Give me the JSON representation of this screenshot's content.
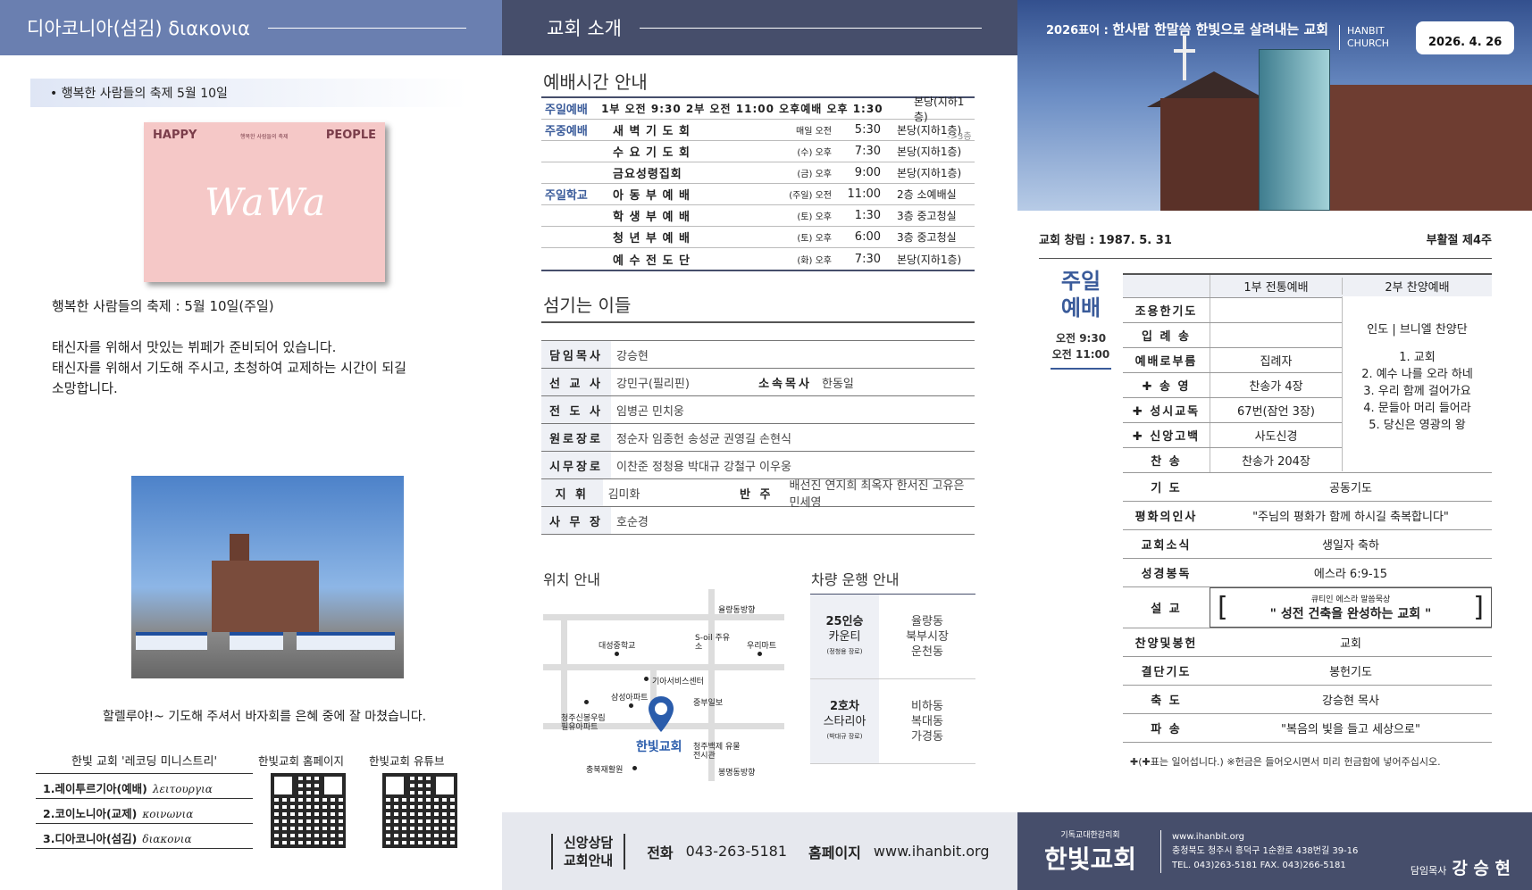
{
  "diakonia": {
    "header": "디아코니아(섬김) διακονια",
    "bullet": "• 행복한 사람들의 축제 5월 10일",
    "card": {
      "left": "HAPPY",
      "right": "PEOPLE",
      "small": "행복한 사람들의 축제",
      "logo": "WaWa"
    },
    "p1": "행복한 사람들의 축제 : 5월 10일(주일)",
    "p2": "태신자를 위해서 맛있는 뷔페가 준비되어 있습니다.",
    "p3": "태신자를 위해서 기도해 주시고, 초청하여 교제하는 시간이 되길",
    "p4": "소망합니다.",
    "caption": "할렐루야!~ 기도해 주셔서 바자회를 은혜 중에 잘 마쳤습니다.",
    "ministry": {
      "title": "한빛 교회 '레코딩 미니스트리'",
      "items": [
        {
          "k": "1.레이투르기아(예배)",
          "g": "λειτουργια"
        },
        {
          "k": "2.코이노니아(교제)",
          "g": "κοινωνια"
        },
        {
          "k": "3.디아코니아(섬김)",
          "g": "διακονια"
        }
      ]
    },
    "qr1": "한빛교회 홈페이지",
    "qr2": "한빛교회 유튜브"
  },
  "intro": {
    "header": "교회 소개",
    "worship_title": "예배시간 안내",
    "worship": [
      [
        "주일예배",
        "1부 오전 9:30   2부 오전 11:00   오후예배 오후 1:30",
        "",
        "",
        "본당(지하1층)"
      ],
      [
        "주중예배",
        "새 벽 기 도 회",
        "매일 오전",
        "5:30",
        "본당(지하1층)"
      ],
      [
        "",
        "수 요 기 도 회",
        "(수) 오후",
        "7:30",
        "본당(지하1층)"
      ],
      [
        "",
        "금요성령집회",
        "(금) 오후",
        "9:00",
        "본당(지하1층)"
      ],
      [
        "주일학교",
        "아 동 부 예 배",
        "(주일) 오전",
        "11:00",
        "2층 소예배실"
      ],
      [
        "",
        "학 생 부 예 배",
        "(토) 오후",
        "1:30",
        "3층 중고청실"
      ],
      [
        "",
        "청 년 부 예 배",
        "(토) 오후",
        "6:00",
        "3층 중고청실"
      ],
      [
        "",
        "예 수 전 도 단",
        "(화) 오후",
        "7:30",
        "본당(지하1층)"
      ]
    ],
    "side": "->3층",
    "staff_title": "섬기는 이들",
    "staff": [
      {
        "l": "담임목사",
        "v": "강승현"
      },
      {
        "l": "선 교 사",
        "v": "강민구(필리핀)",
        "l2": "소속목사",
        "v2": "한동일"
      },
      {
        "l": "전 도 사",
        "v": "임병곤  민치웅"
      },
      {
        "l": "원로장로",
        "v": "정순자  임종헌  송성균  권영길  손현식"
      },
      {
        "l": "시무장로",
        "v": "이찬준  정청용  박대규  강철구  이우웅"
      },
      {
        "l": "지    휘",
        "v": "김미화",
        "l2": "반  주",
        "v2": "배선진  연지희  최옥자  한서진  고유은  민세영"
      },
      {
        "l": "사 무 장",
        "v": "호순경"
      }
    ],
    "map_title": "위치 안내",
    "map": {
      "a": "율량동방향",
      "b": "대성중학교",
      "c": "S-oil 주유소",
      "d": "우리마트",
      "e": "기아서비스센터",
      "f": "삼성아파트",
      "g": "중부일보",
      "h": "청주신봉우림 필유아파트",
      "i": "한빛교회",
      "j": "청주백제 유물전시관",
      "k": "충북재활원",
      "l": "봉명동방향"
    },
    "bus_title": "차량 운행 안내",
    "bus": [
      {
        "n": "25인승",
        "c": "카운티",
        "d": "(정청용 장로)",
        "r1": "율량동",
        "r2": "북부시장",
        "r3": "운천동"
      },
      {
        "n": "2호차",
        "c": "스타리아",
        "d": "(박대규 장로)",
        "r1": "비하동",
        "r2": "복대동",
        "r3": "가경동"
      }
    ],
    "footer": {
      "box": "신앙상담\n교회안내",
      "tel_l": "전화",
      "tel": "043-263-5181",
      "web_l": "홈페이지",
      "web": "www.ihanbit.org"
    }
  },
  "bulletin": {
    "motto_a": "2026표어 : ",
    "motto_b": "한사람 한말씀 한빛으로 살려내는 교회",
    "brand1": "HANBIT",
    "brand2": "CHURCH",
    "date": "2026. 4. 26",
    "founded": "교회 창립 : 1987. 5. 31",
    "season": "부활절 제4주",
    "sun1": "주일",
    "sun2": "예배",
    "t1": "오전 9:30",
    "t2": "오전 11:00",
    "h1": "1부 전통예배",
    "h2": "2부 찬양예배",
    "rows": [
      {
        "k": "조용한기도",
        "a": ""
      },
      {
        "k": "입 례 송",
        "a": ""
      },
      {
        "k": "예배로부름",
        "a": "집례자"
      },
      {
        "k": "✚ 송   영",
        "a": "찬송가 4장"
      },
      {
        "k": "✚ 성시교독",
        "a": "67번(잠언 3장)"
      },
      {
        "k": "✚ 신앙고백",
        "a": "사도신경"
      },
      {
        "k": "찬   송",
        "a": "찬송가 204장"
      }
    ],
    "praise": [
      "인도 | 브니엘 찬양단",
      "",
      "1. 교회",
      "2. 예수 나를 오라 하네",
      "3. 우리 함께 걸어가요",
      "4. 문들아 머리 들어라",
      "5. 당신은 영광의 왕"
    ],
    "rows2": [
      {
        "k": "기   도",
        "v": "공동기도"
      },
      {
        "k": "평화의인사",
        "v": "\"주님의 평화가 함께 하시길 축복합니다\""
      },
      {
        "k": "교회소식",
        "v": "생일자 축하"
      },
      {
        "k": "성경봉독",
        "v": "에스라 6:9-15"
      }
    ],
    "sermon_k": "설   교",
    "sermon_s": "큐티인 에스라 말씀묵상",
    "sermon_t": "\" 성전 건축을 완성하는 교회 \"",
    "rows3": [
      {
        "k": "찬양및봉헌",
        "v": "교회"
      },
      {
        "k": "결단기도",
        "v": "봉헌기도"
      },
      {
        "k": "축   도",
        "v": "강승현 목사"
      },
      {
        "k": "파   송",
        "v": "\"복음의 빛을 들고 세상으로\""
      }
    ],
    "note": "✚(✚표는 일어섭니다.) ※헌금은 들어오시면서 미리 헌금함에 넣어주십시오.",
    "f_small": "기독교대한감리회",
    "f_logo": "한빛교회",
    "f_web": "www.ihanbit.org",
    "f_addr": "충청북도 청주시 흥덕구 1순환로 438번길 39-16",
    "f_tel": "TEL. 043)263-5181    FAX. 043)266-5181",
    "f_pl": "담임목사",
    "f_pn": "강 승 현"
  }
}
